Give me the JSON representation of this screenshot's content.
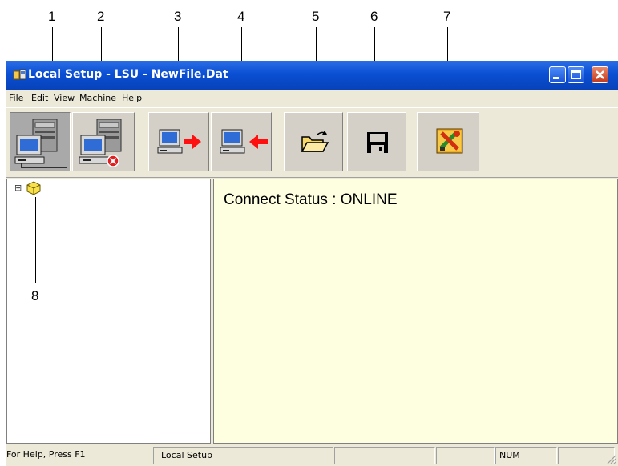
{
  "callouts": [
    "1",
    "2",
    "3",
    "4",
    "5",
    "6",
    "7",
    "8"
  ],
  "window": {
    "title": "Local Setup - LSU - NewFile.Dat",
    "controls": [
      "minimize-icon",
      "maximize-icon",
      "close-icon"
    ]
  },
  "menu": [
    {
      "label": "File"
    },
    {
      "label": "Edit"
    },
    {
      "label": "View"
    },
    {
      "label": "Machine"
    },
    {
      "label": "Help"
    }
  ],
  "toolbar": {
    "buttons": [
      {
        "icon": "connect-machine-icon",
        "state": "pressed"
      },
      {
        "icon": "disconnect-machine-icon",
        "state": "normal"
      },
      {
        "icon": "send-to-machine-icon",
        "state": "normal"
      },
      {
        "icon": "receive-from-machine-icon",
        "state": "normal"
      },
      {
        "icon": "open-folder-icon",
        "state": "normal"
      },
      {
        "icon": "save-disk-icon",
        "state": "normal"
      },
      {
        "icon": "settings-tools-icon",
        "state": "normal"
      }
    ]
  },
  "tree": {
    "expander": "⊞",
    "root_icon": "yellow-cube-icon"
  },
  "content": {
    "connect_status": "Connect Status : ONLINE",
    "background_color": "#fefee0"
  },
  "statusbar": {
    "help_text": "For Help, Press F1",
    "app_text": "Local Setup",
    "num_indicator": "NUM"
  },
  "colors": {
    "title_bar": "#0a4fd4",
    "window_face": "#ece9d8",
    "arrow_red": "#ff1010",
    "close_button": "#c2391b"
  }
}
